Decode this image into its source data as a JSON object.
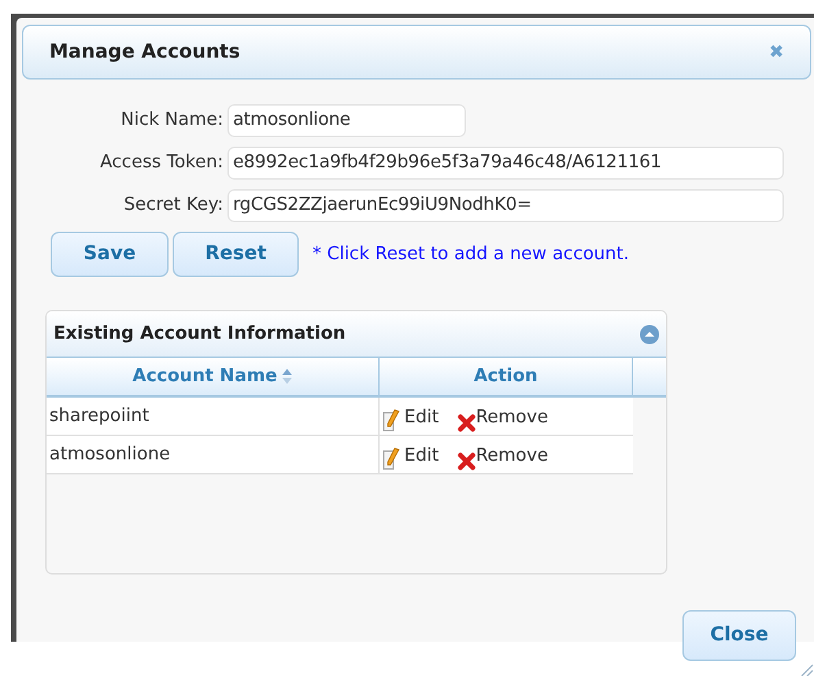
{
  "dialog": {
    "title": "Manage Accounts",
    "close_icon": "✖"
  },
  "form": {
    "fields": [
      {
        "label": "Nick Name:",
        "value": "atmosonlione",
        "kind": "short"
      },
      {
        "label": "Access Token:",
        "value": "e8992ec1a9fb4f29b96e5f3a79a46c48/A6121161",
        "kind": "long"
      },
      {
        "label": "Secret Key:",
        "value": "rgCGS2ZZjaerunEc99iU9NodhK0=",
        "kind": "long"
      }
    ],
    "buttons": [
      "Save",
      "Reset"
    ],
    "note": "* Click Reset to add a new account."
  },
  "panel": {
    "title": "Existing Account Information",
    "expanded": true,
    "columns": [
      {
        "label": "Account Name",
        "sortable": true
      },
      {
        "label": "Action",
        "sortable": false
      }
    ],
    "rows": [
      {
        "account_name": "sharepoiint",
        "actions": [
          "Edit",
          "Remove"
        ]
      },
      {
        "account_name": "atmosonlione",
        "actions": [
          "Edit",
          "Remove"
        ]
      }
    ]
  },
  "footer_button": "Close"
}
